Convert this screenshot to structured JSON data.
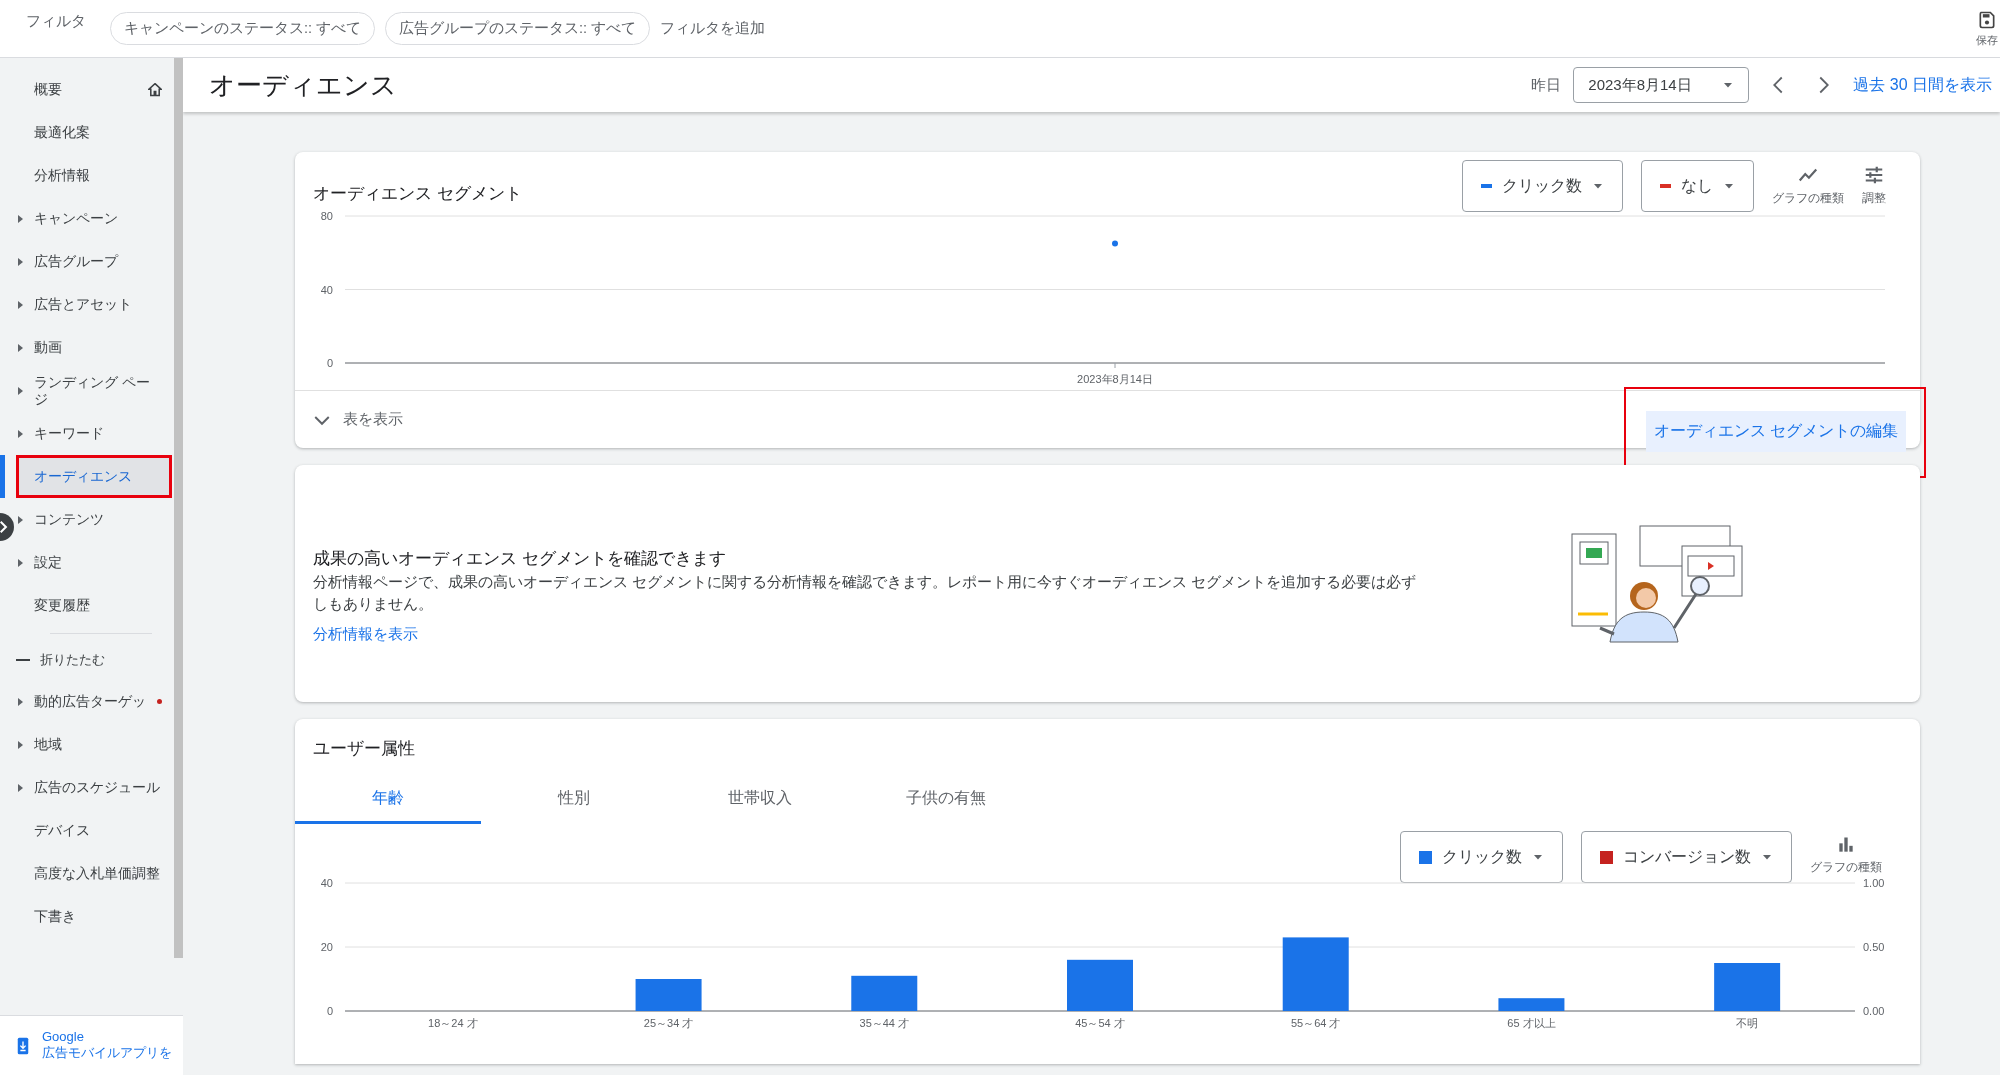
{
  "filter_bar": {
    "label": "フィルタ",
    "chips": [
      "キャンペーンのステータス:: すべて",
      "広告グループのステータス:: すべて"
    ],
    "add_filter": "フィルタを追加",
    "save": "保存"
  },
  "sidebar": {
    "items": [
      {
        "label": "概要",
        "expandable": false,
        "selected": false,
        "home": true
      },
      {
        "label": "最適化案",
        "expandable": false,
        "selected": false
      },
      {
        "label": "分析情報",
        "expandable": false,
        "selected": false
      },
      {
        "label": "キャンペーン",
        "expandable": true,
        "selected": false
      },
      {
        "label": "広告グループ",
        "expandable": true,
        "selected": false
      },
      {
        "label": "広告とアセット",
        "expandable": true,
        "selected": false
      },
      {
        "label": "動画",
        "expandable": true,
        "selected": false
      },
      {
        "label": "ランディング ページ",
        "expandable": true,
        "selected": false
      },
      {
        "label": "キーワード",
        "expandable": true,
        "selected": false
      },
      {
        "label": "オーディエンス",
        "expandable": false,
        "selected": true,
        "annotated": true
      },
      {
        "label": "コンテンツ",
        "expandable": true,
        "selected": false
      },
      {
        "label": "設定",
        "expandable": true,
        "selected": false
      },
      {
        "label": "変更履歴",
        "expandable": false,
        "selected": false
      }
    ],
    "collapse": "折りたたむ",
    "more_items": [
      {
        "label": "動的広告ターゲッ",
        "expandable": true,
        "selected": false,
        "alert": true
      },
      {
        "label": "地域",
        "expandable": true,
        "selected": false
      },
      {
        "label": "広告のスケジュール",
        "expandable": true,
        "selected": false
      },
      {
        "label": "デバイス",
        "expandable": false,
        "selected": false
      },
      {
        "label": "高度な入札単価調整",
        "expandable": false,
        "selected": false
      },
      {
        "label": "下書き",
        "expandable": false,
        "selected": false
      }
    ],
    "app_promo": {
      "line1": "Google",
      "line2": "広告モバイルアプリを"
    }
  },
  "header": {
    "title": "オーディエンス",
    "date_label": "昨日",
    "date": "2023年8月14日",
    "range_link": "過去 30 日間を表示"
  },
  "segment_card": {
    "title": "オーディエンス セグメント",
    "metrics": [
      {
        "color": "#1a73e8"
      },
      {
        "label": "なし",
        "color": "#d93025"
      }
    ],
    "chart_type": "グラフの種類",
    "adjust": "調整",
    "chart_data": {
      "type": "line",
      "x": [
        "2023年8月14日"
      ],
      "series": [
        {
          "name": "クリック数",
          "color": "#1a73e8",
          "values": [
            65
          ],
          "marker": "circle"
        }
      ],
      "ylim": [
        0,
        80
      ],
      "yticks": [
        0,
        40,
        80
      ]
    },
    "show_table": "表を表示",
    "edit_link": "オーディエンス セグメントの編集",
    "edit_annotated": true
  },
  "insight_card": {
    "title": "成果の高いオーディエンス セグメントを確認できます",
    "body": "分析情報ページで、成果の高いオーディエンス セグメントに関する分析情報を確認できます。レポート用に今すぐオーディエンス セグメントを追加する必要は必ずしもありません。",
    "link": "分析情報を表示"
  },
  "demographics_card": {
    "title": "ユーザー属性",
    "tabs": [
      {
        "label": "年齢",
        "selected": true
      },
      {
        "label": "性別",
        "selected": false
      },
      {
        "label": "世帯収入",
        "selected": false
      },
      {
        "label": "子供の有無",
        "selected": false
      }
    ],
    "metrics": [
      {
        "color": "#1a73e8"
      },
      {
        "label": "コンバージョン数",
        "color": "#c5221f"
      }
    ],
    "chart_type": "グラフの種類",
    "chart_data": {
      "type": "bar",
      "categories": [
        "18～24 才",
        "25～34 才",
        "35～44 才",
        "45～54 才",
        "55～64 才",
        "65 才以上",
        "不明"
      ],
      "series": [
        {
          "name": "クリック数",
          "color": "#1a73e8",
          "values": [
            0,
            10,
            11,
            16,
            23,
            4,
            15
          ]
        }
      ],
      "ylim": [
        0,
        40
      ],
      "yticks": [
        0,
        20,
        40
      ],
      "annotations": [
        {
          "text": "0.00"
        },
        {
          "text": "0.50"
        },
        {
          "text": "1.00"
        }
      ]
    }
  }
}
